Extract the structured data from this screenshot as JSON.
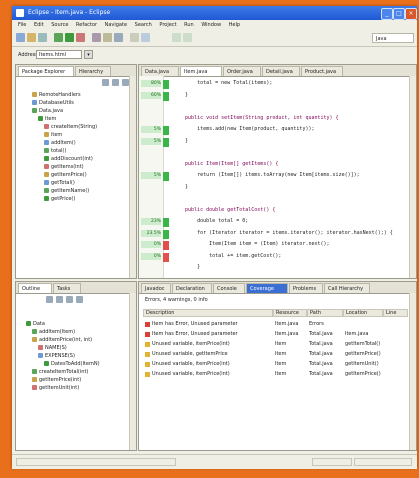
{
  "window": {
    "title": "Eclipse - Item.java - Eclipse"
  },
  "menu": [
    "File",
    "Edit",
    "Source",
    "Refactor",
    "Navigate",
    "Search",
    "Project",
    "Run",
    "Window",
    "Help"
  ],
  "toolbar": {
    "perspective": "Java"
  },
  "address": {
    "label": "Address:",
    "value": "Items.html"
  },
  "explorer": {
    "tabs": [
      "Package Explorer",
      "Hierarchy"
    ],
    "items": [
      {
        "label": "RemoteHandlers",
        "depth": 2
      },
      {
        "label": "DatabaseUtils",
        "depth": 2
      },
      {
        "label": "Data.java",
        "depth": 2
      },
      {
        "label": "Item",
        "depth": 3
      },
      {
        "label": "createItem(String)",
        "depth": 4
      },
      {
        "label": "item",
        "depth": 4
      },
      {
        "label": "addItem()",
        "depth": 4
      },
      {
        "label": "total()",
        "depth": 4
      },
      {
        "label": "addDiscount(int)",
        "depth": 4
      },
      {
        "label": "getItems(int)",
        "depth": 4
      },
      {
        "label": "getItemPrice()",
        "depth": 4
      },
      {
        "label": "getTotal()",
        "depth": 4
      },
      {
        "label": "getItemName()",
        "depth": 4
      },
      {
        "label": "getPrice()",
        "depth": 4
      }
    ]
  },
  "editor": {
    "tabs": [
      "Data.java",
      "Item.java",
      "Order.java",
      "Detail.java",
      "Product.java"
    ],
    "lines": [
      {
        "cov": "80%",
        "text": "        total = new Total(items);",
        "color": "green"
      },
      {
        "cov": "60%",
        "text": "    }",
        "color": "green"
      },
      {
        "cov": "",
        "text": "",
        "color": ""
      },
      {
        "cov": "",
        "text": "    public void setItem(String product, int quantity) {",
        "color": ""
      },
      {
        "cov": "5%",
        "text": "        items.add(new Item(product, quantity));",
        "color": "green"
      },
      {
        "cov": "5%",
        "text": "    }",
        "color": "green"
      },
      {
        "cov": "",
        "text": "",
        "color": ""
      },
      {
        "cov": "",
        "text": "    public Item(Item[] getItems() {",
        "color": ""
      },
      {
        "cov": "5%",
        "text": "        return (Item[]) items.toArray(new Item[items.size()]);",
        "color": "green"
      },
      {
        "cov": "",
        "text": "    }",
        "color": ""
      },
      {
        "cov": "",
        "text": "",
        "color": ""
      },
      {
        "cov": "",
        "text": "    public double getTotalCost() {",
        "color": ""
      },
      {
        "cov": "23%",
        "text": "        double total = 0;",
        "color": "green"
      },
      {
        "cov": "23.5%",
        "text": "        for (Iterator iterator = items.iterator(); iterator.hasNext();) {",
        "color": "green"
      },
      {
        "cov": "0%",
        "text": "            Item(Item item = (Item) iterator.next();",
        "color": "red"
      },
      {
        "cov": "0%",
        "text": "            total += item.getCost();",
        "color": "red"
      },
      {
        "cov": "",
        "text": "        }",
        "color": ""
      }
    ]
  },
  "outline": {
    "tabs": [
      "Outline",
      "Tasks"
    ],
    "items": [
      {
        "label": "Data",
        "depth": 1
      },
      {
        "label": "addItem(Item)",
        "depth": 2
      },
      {
        "label": "addItemPrice(int, int)",
        "depth": 2
      },
      {
        "label": "NAME(S)",
        "depth": 3
      },
      {
        "label": "EXPENSE(S)",
        "depth": 3
      },
      {
        "label": "DatesToAdd(ItemN)",
        "depth": 4
      },
      {
        "label": "createItemTotal(int)",
        "depth": 2
      },
      {
        "label": "getItemPrice(int)",
        "depth": 2
      },
      {
        "label": "getItemUnit(int)",
        "depth": 2
      }
    ]
  },
  "problems": {
    "tabs": [
      "Javadoc",
      "Declaration",
      "Console",
      "Coverage",
      "Problems",
      "Call Hierarchy"
    ],
    "active_index": 3,
    "summary": "Errors, 4 warnings, 0 info",
    "columns": [
      "Description",
      "Resource",
      "Path",
      "Location",
      "Line"
    ],
    "rows": [
      [
        "Item has Error, Unused parameter",
        "Item.java",
        "Errors",
        "",
        ""
      ],
      [
        "Item has Error, Unused parameter",
        "Item.java",
        "Total.java",
        "Item.java",
        ""
      ],
      [
        "Unused variable, itemPrice(int)",
        "Item",
        "Total.java",
        "getItemTotal()",
        ""
      ],
      [
        "Unused variable, getItemPrice",
        "Item",
        "Total.java",
        "getItemPrice()",
        ""
      ],
      [
        "Unused variable, itemPrice(int)",
        "Item",
        "Total.java",
        "getItemUnit()",
        ""
      ],
      [
        "Unused variable, itemPrice(int)",
        "Item",
        "Total.java",
        "getItemPrice()",
        ""
      ]
    ]
  },
  "colors": {
    "accent": "#1f58d6",
    "desktop": "#e8701c",
    "coverage_green": "#39b54a",
    "coverage_red": "#e2504c"
  }
}
